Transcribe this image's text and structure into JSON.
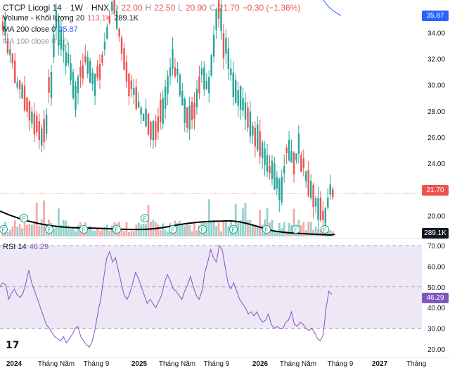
{
  "header": {
    "symbol": "CTCP Licogi 14",
    "interval": "1W",
    "exchange": "HNX",
    "ohlc": [
      {
        "label": "O",
        "value": "22.00"
      },
      {
        "label": "H",
        "value": "22.50"
      },
      {
        "label": "L",
        "value": "20.90"
      },
      {
        "label": "C",
        "value": "21.70"
      }
    ],
    "change": "−0.30 (−1.36%)",
    "volume_label": "Volume - Khối lượng 20",
    "volume_ma": "113.1K",
    "volume_value": "289.1K",
    "ma200_label": "MA 200 close 0",
    "ma200_value": "35.87",
    "ma100_label": "MA 100 close 0",
    "eye_icon": "eye-icon"
  },
  "rsi_legend": {
    "label": "RSI 14",
    "value": "46.29"
  },
  "price_badges": {
    "ma200": "35.87",
    "last": "21.70",
    "volume": "289.1K",
    "rsi": "46.29"
  },
  "logo": "17",
  "colors": {
    "up": "#26a69a",
    "down": "#ef5350",
    "ma": "#2962ff",
    "rsi": "#7e57c2",
    "rsi_band": "#ede7f6",
    "volume_ma": "#000000"
  },
  "chart_data": [
    {
      "type": "candlestick",
      "title": "CTCP Licogi 14 · 1W · HNX",
      "y_axis_ticks": [
        20.0,
        22.0,
        24.0,
        26.0,
        28.0,
        30.0,
        32.0,
        34.0
      ],
      "ylim": [
        18.4,
        36.5
      ],
      "current_price_line": 21.7,
      "x_axis_labels": [
        "2024",
        "Tháng Năm",
        "Tháng 9",
        "2025",
        "Tháng Năm",
        "Tháng 9",
        "2026",
        "Tháng Năm",
        "Tháng 9",
        "2027",
        "Tháng"
      ],
      "dividend_markers": "F",
      "candles": []
    },
    {
      "type": "line",
      "title": "RSI 14",
      "y_axis_ticks": [
        20.0,
        30.0,
        40.0,
        50.0,
        60.0,
        70.0
      ],
      "ylim": [
        17,
        73
      ],
      "levels": [
        70,
        50,
        30
      ],
      "last_value": 46.29,
      "series": [
        {
          "values": [
            50,
            52,
            51,
            44,
            47,
            49,
            46,
            45,
            47,
            52,
            58,
            52,
            48,
            44,
            40,
            36,
            32,
            30,
            28,
            26,
            25,
            24,
            26,
            23,
            25,
            27,
            30,
            31,
            26,
            24,
            22,
            21,
            24,
            30,
            38,
            45,
            55,
            64,
            67,
            62,
            64,
            58,
            52,
            46,
            44,
            47,
            52,
            57,
            54,
            50,
            46,
            42,
            44,
            42,
            40,
            43,
            46,
            52,
            56,
            53,
            49,
            48,
            46,
            44,
            48,
            51,
            55,
            50,
            46,
            44,
            48,
            57,
            62,
            68,
            64,
            62,
            70,
            68,
            60,
            52,
            49,
            52,
            48,
            44,
            42,
            40,
            37,
            38,
            36,
            38,
            35,
            33,
            34,
            37,
            32,
            30,
            31,
            30,
            30,
            33,
            34,
            38,
            32,
            31,
            33,
            32,
            30,
            29,
            30,
            28,
            25,
            24,
            27,
            40,
            48,
            46.3
          ]
        }
      ]
    }
  ]
}
